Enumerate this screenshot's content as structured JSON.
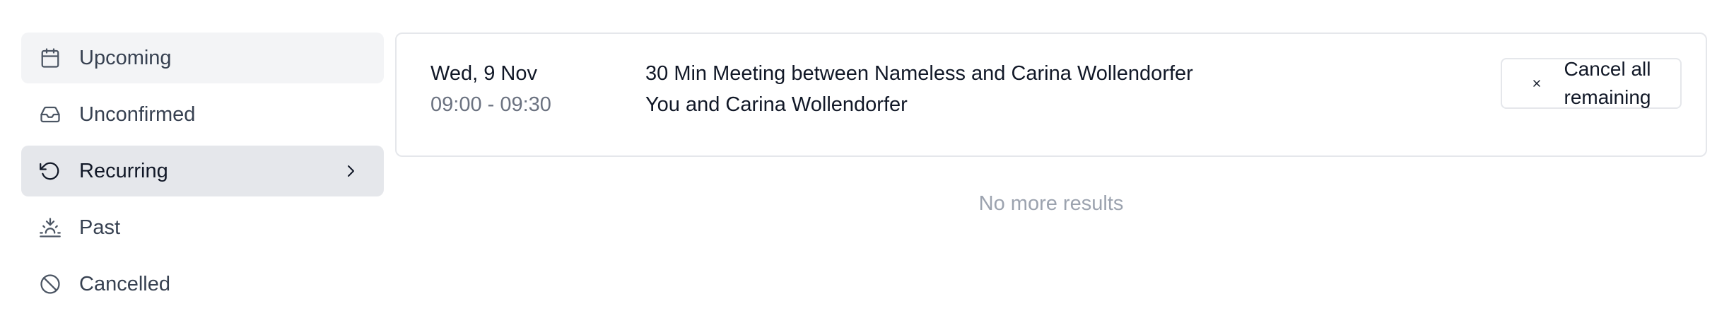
{
  "sidebar": {
    "items": [
      {
        "label": "Upcoming",
        "icon": "calendar-icon"
      },
      {
        "label": "Unconfirmed",
        "icon": "inbox-icon"
      },
      {
        "label": "Recurring",
        "icon": "rotate-ccw-icon"
      },
      {
        "label": "Past",
        "icon": "sunset-icon"
      },
      {
        "label": "Cancelled",
        "icon": "ban-icon"
      }
    ],
    "active": "Recurring"
  },
  "booking": {
    "date": "Wed, 9 Nov",
    "time": "09:00 - 09:30",
    "title": "30 Min Meeting between Nameless and Carina Wollendorfer",
    "attendees": "You and Carina Wollendorfer",
    "cancel_label": "Cancel all remaining"
  },
  "footer": {
    "no_more": "No more results"
  },
  "colors": {
    "active_bg": "#e5e7eb",
    "upcoming_bg": "#f3f4f6",
    "muted_text": "#6b7280",
    "faint_text": "#9ca3af",
    "border": "#e5e7eb"
  }
}
